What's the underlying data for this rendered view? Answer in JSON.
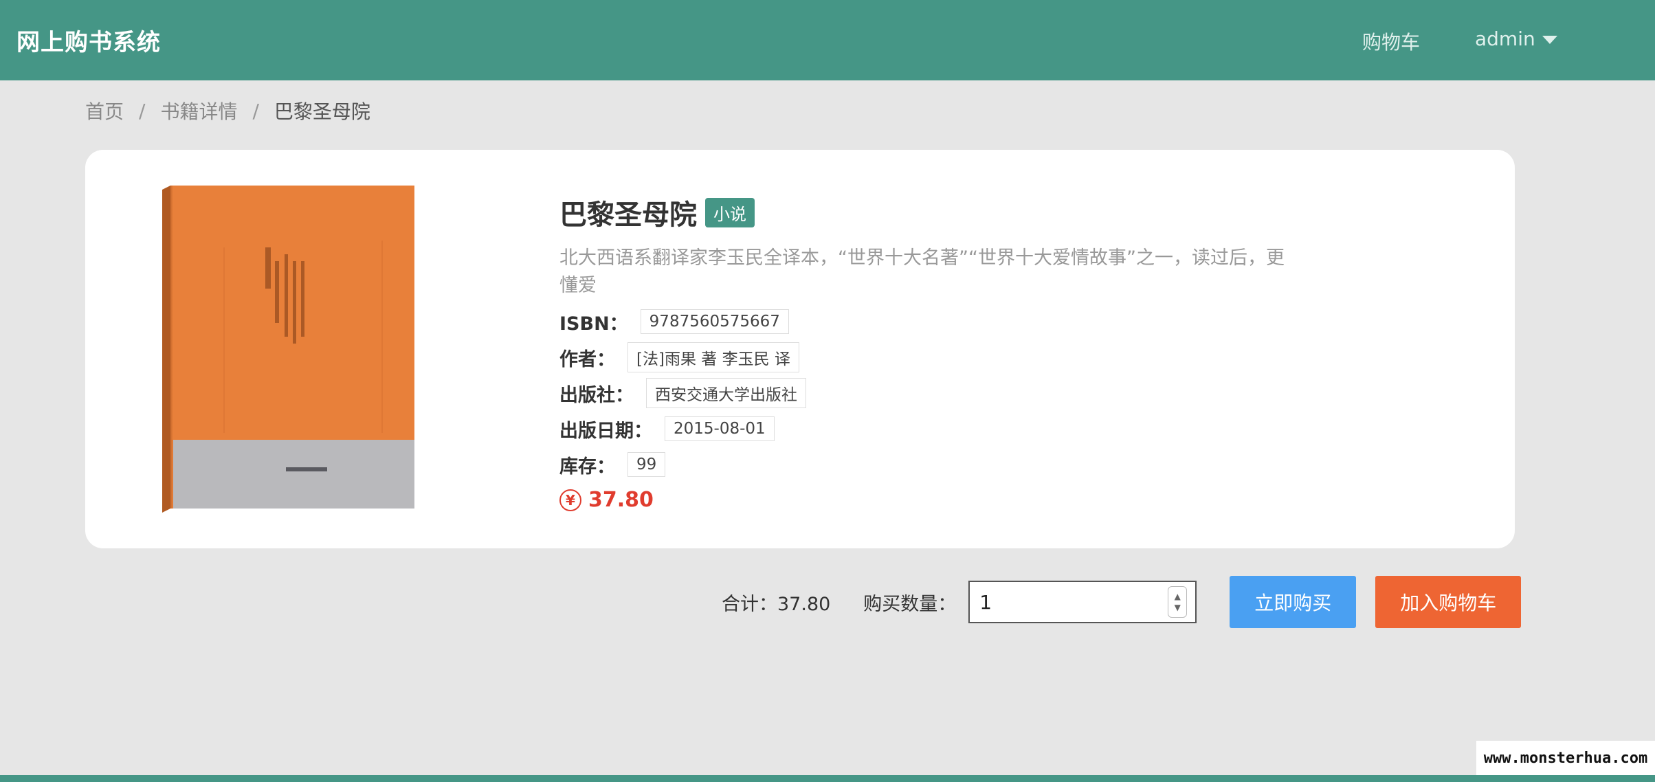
{
  "nav": {
    "brand": "网上购书系统",
    "cart": "购物车",
    "user": "admin"
  },
  "breadcrumb": {
    "home": "首页",
    "detail": "书籍详情",
    "current": "巴黎圣母院",
    "separator": "/"
  },
  "book": {
    "title": "巴黎圣母院",
    "tag": "小说",
    "description": "北大西语系翻译家李玉民全译本，“世界十大名著”“世界十大爱情故事”之一，读过后，更懂爱",
    "fields": [
      {
        "label": "ISBN：",
        "value": "9787560575667"
      },
      {
        "label": "作者：",
        "value": "[法]雨果 著 李玉民 译"
      },
      {
        "label": "出版社：",
        "value": "西安交通大学出版社"
      },
      {
        "label": "出版日期：",
        "value": "2015-08-01"
      },
      {
        "label": "库存：",
        "value": "99"
      }
    ],
    "price_symbol": "¥",
    "price": "37.80",
    "cover_colors": {
      "top": "#e8803a",
      "bottom": "#b9b9bc"
    }
  },
  "purchase": {
    "total": "合计：37.80",
    "qty_label": "购买数量：",
    "qty_value": "1",
    "buy_label": "立即购买",
    "cart_label": "加入购物车"
  },
  "colors": {
    "primary": "#459686",
    "buy": "#4aa0f2",
    "cart": "#ee6533",
    "price": "#e03c2e"
  },
  "watermark": "www.monsterhua.com"
}
